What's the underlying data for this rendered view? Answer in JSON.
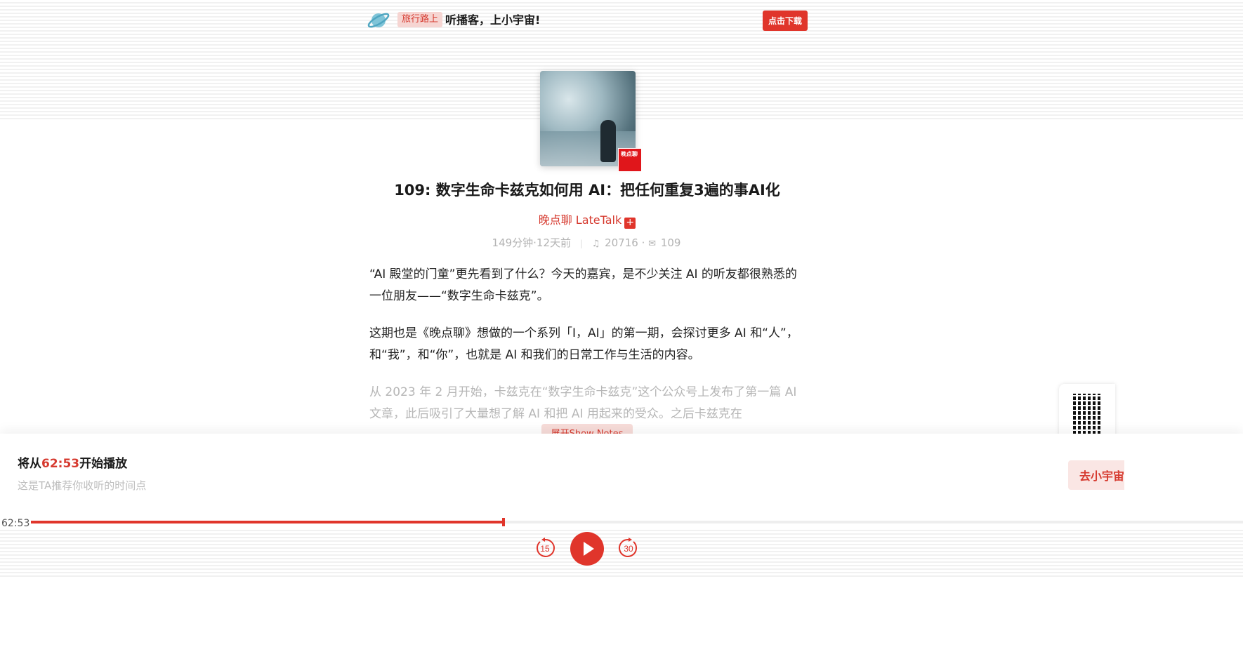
{
  "header": {
    "tag": "旅行路上",
    "slogan": "听播客，上小宇宙!",
    "download_label": "点击下载"
  },
  "episode": {
    "cover_badge": "晚点聊",
    "title": "109: 数字生命卡兹克如何用 AI：把任何重复3遍的事AI化",
    "podcast": "晚点聊 LateTalk",
    "duration_age": "149分钟·12天前",
    "plays": "20716",
    "comments": "109",
    "description": [
      "“AI 殿堂的门童”更先看到了什么？今天的嘉宾，是不少关注 AI 的听友都很熟悉的一位朋友——“数字生命卡兹克”。",
      "这期也是《晚点聊》想做的一个系列「I，AI」的第一期，会探讨更多 AI 和“人”，和“我”，和“你”，也就是 AI 和我们的日常工作与生活的内容。",
      "从 2023 年 2 月开始，卡兹克在“数字生命卡兹克”这个公众号上发布了第一篇 AI 文章，此后吸引了大量想了解 AI 和把 AI 用起来的受众。之后卡兹克在"
    ],
    "expand_label": "展开Show Notes"
  },
  "resume": {
    "prefix": "将从",
    "time": "62:53",
    "suffix": "开始播放",
    "subtitle": "这是TA推荐你收听的时间点",
    "app_button": "去小宇宙"
  },
  "player": {
    "current_time": "62:53",
    "progress": 0.39,
    "rewind_seconds": "15",
    "forward_seconds": "30"
  },
  "colors": {
    "accent": "#e0352b",
    "muted": "#b3b3b3"
  }
}
